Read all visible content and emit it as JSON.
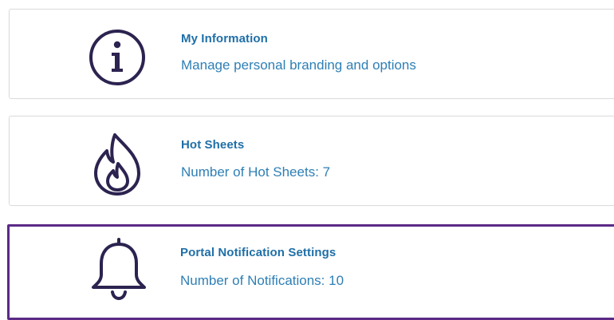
{
  "cards": [
    {
      "title": "My Information",
      "description": "Manage personal branding and options",
      "icon": "info-icon"
    },
    {
      "title": "Hot Sheets",
      "description": "Number of Hot Sheets: 7",
      "icon": "flame-icon"
    },
    {
      "title": "Portal Notification Settings",
      "description": "Number of Notifications: 10",
      "icon": "bell-icon"
    }
  ],
  "colors": {
    "icon": "#2c2350",
    "title": "#1f6fa8",
    "description": "#2e7fb5",
    "selected_border": "#5b2a86",
    "card_border": "#dcdcdc"
  }
}
